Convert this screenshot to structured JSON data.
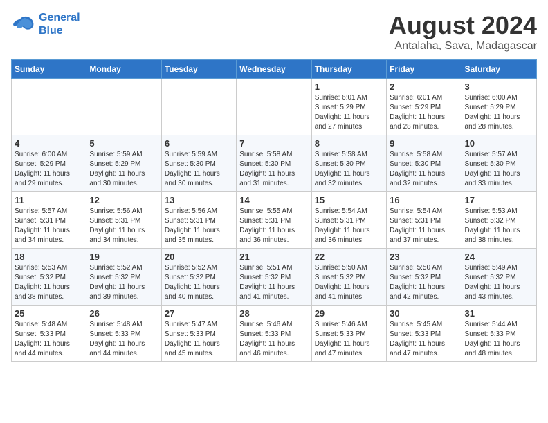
{
  "header": {
    "logo_line1": "General",
    "logo_line2": "Blue",
    "main_title": "August 2024",
    "subtitle": "Antalaha, Sava, Madagascar"
  },
  "calendar": {
    "days_of_week": [
      "Sunday",
      "Monday",
      "Tuesday",
      "Wednesday",
      "Thursday",
      "Friday",
      "Saturday"
    ],
    "weeks": [
      [
        {
          "day": "",
          "info": ""
        },
        {
          "day": "",
          "info": ""
        },
        {
          "day": "",
          "info": ""
        },
        {
          "day": "",
          "info": ""
        },
        {
          "day": "1",
          "info": "Sunrise: 6:01 AM\nSunset: 5:29 PM\nDaylight: 11 hours\nand 27 minutes."
        },
        {
          "day": "2",
          "info": "Sunrise: 6:01 AM\nSunset: 5:29 PM\nDaylight: 11 hours\nand 28 minutes."
        },
        {
          "day": "3",
          "info": "Sunrise: 6:00 AM\nSunset: 5:29 PM\nDaylight: 11 hours\nand 28 minutes."
        }
      ],
      [
        {
          "day": "4",
          "info": "Sunrise: 6:00 AM\nSunset: 5:29 PM\nDaylight: 11 hours\nand 29 minutes."
        },
        {
          "day": "5",
          "info": "Sunrise: 5:59 AM\nSunset: 5:29 PM\nDaylight: 11 hours\nand 30 minutes."
        },
        {
          "day": "6",
          "info": "Sunrise: 5:59 AM\nSunset: 5:30 PM\nDaylight: 11 hours\nand 30 minutes."
        },
        {
          "day": "7",
          "info": "Sunrise: 5:58 AM\nSunset: 5:30 PM\nDaylight: 11 hours\nand 31 minutes."
        },
        {
          "day": "8",
          "info": "Sunrise: 5:58 AM\nSunset: 5:30 PM\nDaylight: 11 hours\nand 32 minutes."
        },
        {
          "day": "9",
          "info": "Sunrise: 5:58 AM\nSunset: 5:30 PM\nDaylight: 11 hours\nand 32 minutes."
        },
        {
          "day": "10",
          "info": "Sunrise: 5:57 AM\nSunset: 5:30 PM\nDaylight: 11 hours\nand 33 minutes."
        }
      ],
      [
        {
          "day": "11",
          "info": "Sunrise: 5:57 AM\nSunset: 5:31 PM\nDaylight: 11 hours\nand 34 minutes."
        },
        {
          "day": "12",
          "info": "Sunrise: 5:56 AM\nSunset: 5:31 PM\nDaylight: 11 hours\nand 34 minutes."
        },
        {
          "day": "13",
          "info": "Sunrise: 5:56 AM\nSunset: 5:31 PM\nDaylight: 11 hours\nand 35 minutes."
        },
        {
          "day": "14",
          "info": "Sunrise: 5:55 AM\nSunset: 5:31 PM\nDaylight: 11 hours\nand 36 minutes."
        },
        {
          "day": "15",
          "info": "Sunrise: 5:54 AM\nSunset: 5:31 PM\nDaylight: 11 hours\nand 36 minutes."
        },
        {
          "day": "16",
          "info": "Sunrise: 5:54 AM\nSunset: 5:31 PM\nDaylight: 11 hours\nand 37 minutes."
        },
        {
          "day": "17",
          "info": "Sunrise: 5:53 AM\nSunset: 5:32 PM\nDaylight: 11 hours\nand 38 minutes."
        }
      ],
      [
        {
          "day": "18",
          "info": "Sunrise: 5:53 AM\nSunset: 5:32 PM\nDaylight: 11 hours\nand 38 minutes."
        },
        {
          "day": "19",
          "info": "Sunrise: 5:52 AM\nSunset: 5:32 PM\nDaylight: 11 hours\nand 39 minutes."
        },
        {
          "day": "20",
          "info": "Sunrise: 5:52 AM\nSunset: 5:32 PM\nDaylight: 11 hours\nand 40 minutes."
        },
        {
          "day": "21",
          "info": "Sunrise: 5:51 AM\nSunset: 5:32 PM\nDaylight: 11 hours\nand 41 minutes."
        },
        {
          "day": "22",
          "info": "Sunrise: 5:50 AM\nSunset: 5:32 PM\nDaylight: 11 hours\nand 41 minutes."
        },
        {
          "day": "23",
          "info": "Sunrise: 5:50 AM\nSunset: 5:32 PM\nDaylight: 11 hours\nand 42 minutes."
        },
        {
          "day": "24",
          "info": "Sunrise: 5:49 AM\nSunset: 5:32 PM\nDaylight: 11 hours\nand 43 minutes."
        }
      ],
      [
        {
          "day": "25",
          "info": "Sunrise: 5:48 AM\nSunset: 5:33 PM\nDaylight: 11 hours\nand 44 minutes."
        },
        {
          "day": "26",
          "info": "Sunrise: 5:48 AM\nSunset: 5:33 PM\nDaylight: 11 hours\nand 44 minutes."
        },
        {
          "day": "27",
          "info": "Sunrise: 5:47 AM\nSunset: 5:33 PM\nDaylight: 11 hours\nand 45 minutes."
        },
        {
          "day": "28",
          "info": "Sunrise: 5:46 AM\nSunset: 5:33 PM\nDaylight: 11 hours\nand 46 minutes."
        },
        {
          "day": "29",
          "info": "Sunrise: 5:46 AM\nSunset: 5:33 PM\nDaylight: 11 hours\nand 47 minutes."
        },
        {
          "day": "30",
          "info": "Sunrise: 5:45 AM\nSunset: 5:33 PM\nDaylight: 11 hours\nand 47 minutes."
        },
        {
          "day": "31",
          "info": "Sunrise: 5:44 AM\nSunset: 5:33 PM\nDaylight: 11 hours\nand 48 minutes."
        }
      ]
    ]
  }
}
